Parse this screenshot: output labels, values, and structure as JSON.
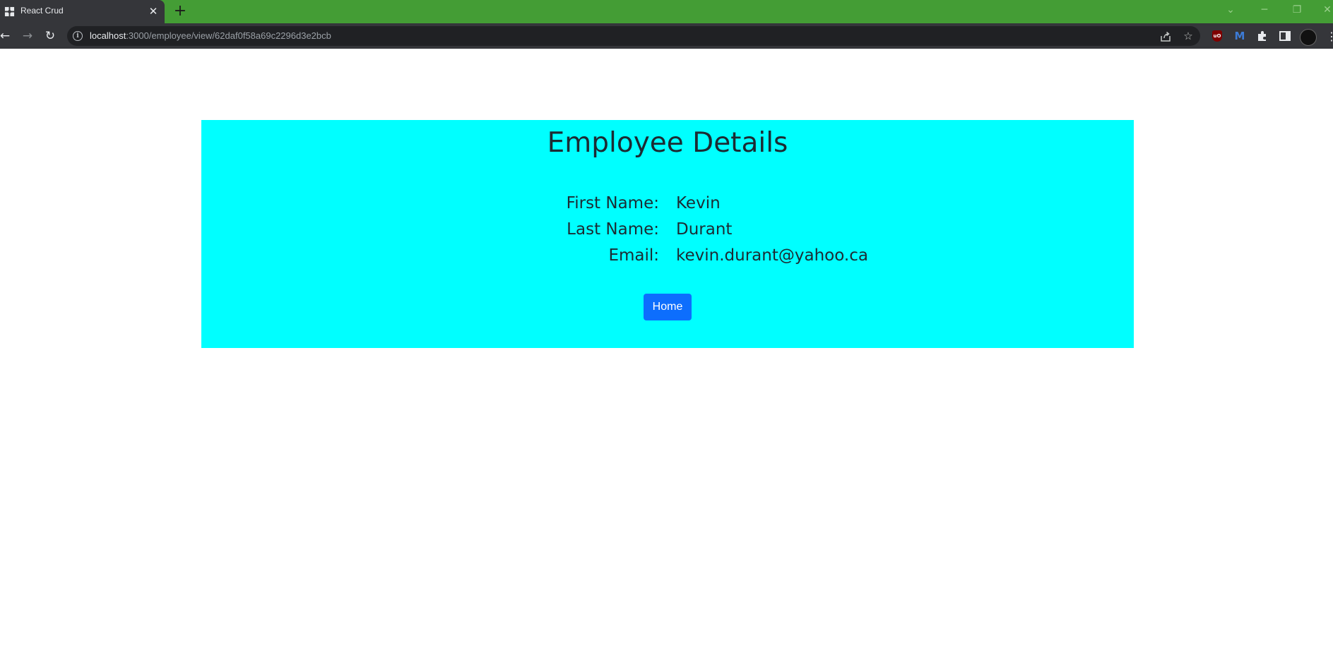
{
  "browser": {
    "tab": {
      "title": "React Crud",
      "close_glyph": "✕"
    },
    "new_tab_glyph": "+",
    "window_controls": [
      "⌄",
      "─",
      "❐",
      "✕"
    ],
    "nav": {
      "back": "←",
      "forward": "→",
      "reload": "↻"
    },
    "address": {
      "host": "localhost",
      "path": ":3000/employee/view/62daf0f58a69c2296d3e2bcb"
    },
    "icons": {
      "share": "share-icon",
      "bookmark_star": "☆",
      "ublock_label": "uO",
      "m_extension": "M",
      "puzzle": "extensions-icon",
      "side_panel": "side-panel-icon",
      "profile": "profile-avatar",
      "menu": "⋮"
    },
    "colors": {
      "frame": "#449d35",
      "toolbar": "#35363a",
      "omnibox": "#202124"
    }
  },
  "page": {
    "title": "Employee Details",
    "fields": [
      {
        "label": "First Name:",
        "value": "Kevin"
      },
      {
        "label": "Last Name:",
        "value": "Durant"
      },
      {
        "label": "Email:",
        "value": "kevin.durant@yahoo.ca"
      }
    ],
    "home_button": "Home",
    "colors": {
      "card_background": "#00ffff",
      "button": "#0d6efd",
      "text": "#1c2b33"
    }
  }
}
